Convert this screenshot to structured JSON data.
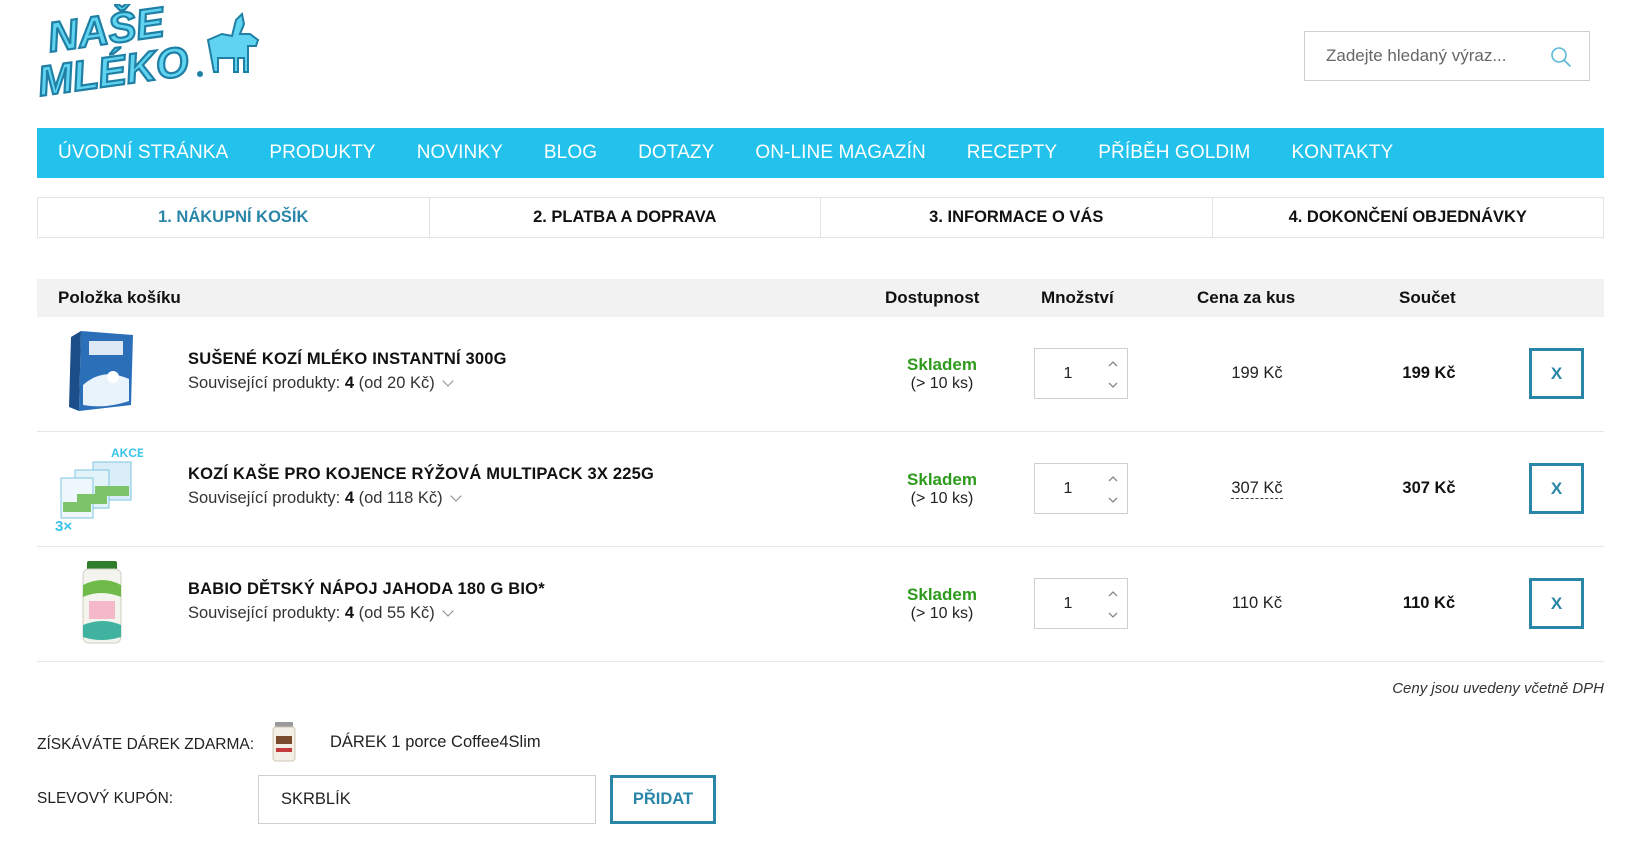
{
  "header": {
    "logo_text_line1": "NAŠE",
    "logo_text_line2": "MLÉKO",
    "search_placeholder": "Zadejte hledaný výraz..."
  },
  "nav": {
    "items": [
      "ÚVODNÍ STRÁNKA",
      "PRODUKTY",
      "NOVINKY",
      "BLOG",
      "DOTAZY",
      "ON-LINE MAGAZÍN",
      "RECEPTY",
      "PŘÍBĚH GOLDIM",
      "KONTAKTY"
    ]
  },
  "steps": [
    {
      "label": "1. NÁKUPNÍ KOŠÍK",
      "active": true
    },
    {
      "label": "2. PLATBA A DOPRAVA",
      "active": false
    },
    {
      "label": "3. INFORMACE O VÁS",
      "active": false
    },
    {
      "label": "4. DOKONČENÍ OBJEDNÁVKY",
      "active": false
    }
  ],
  "cart": {
    "columns": {
      "item": "Položka košíku",
      "availability": "Dostupnost",
      "quantity": "Množství",
      "unit_price": "Cena za kus",
      "total": "Součet"
    },
    "items": [
      {
        "name": "SUŠENÉ KOZÍ MLÉKO INSTANTNÍ 300G",
        "related_prefix": "Související produkty: ",
        "related_count": "4",
        "related_from": " (od 20 Kč)",
        "stock": "Skladem",
        "stock_note": "(> 10 ks)",
        "quantity": "1",
        "unit_price": "199 Kč",
        "total": "199 Kč",
        "remove": "X"
      },
      {
        "name": "KOZÍ KAŠE PRO KOJENCE RÝŽOVÁ MULTIPACK 3X 225G",
        "related_prefix": "Související produkty: ",
        "related_count": "4",
        "related_from": " (od 118 Kč)",
        "stock": "Skladem",
        "stock_note": "(> 10 ks)",
        "quantity": "1",
        "unit_price": "307 Kč",
        "total": "307 Kč",
        "remove": "X",
        "badge": "AKCE",
        "badge_multiplier": "3×"
      },
      {
        "name": "BABIO DĚTSKÝ NÁPOJ JAHODA 180 G BIO*",
        "related_prefix": "Související produkty: ",
        "related_count": "4",
        "related_from": " (od 55 Kč)",
        "stock": "Skladem",
        "stock_note": "(> 10 ks)",
        "quantity": "1",
        "unit_price": "110 Kč",
        "total": "110 Kč",
        "remove": "X"
      }
    ],
    "vat_note": "Ceny jsou uvedeny včetně DPH"
  },
  "gift": {
    "label": "ZÍSKÁVÁTE DÁREK ZDARMA:",
    "name": "DÁREK 1 porce Coffee4Slim"
  },
  "coupon": {
    "label": "SLEVOVÝ KUPÓN:",
    "value": "SKRBLÍK",
    "button": "PŘIDAT"
  },
  "colors": {
    "nav_bg": "#22c2ec",
    "accent": "#2a86a8",
    "stock_green": "#2e9b1d"
  }
}
